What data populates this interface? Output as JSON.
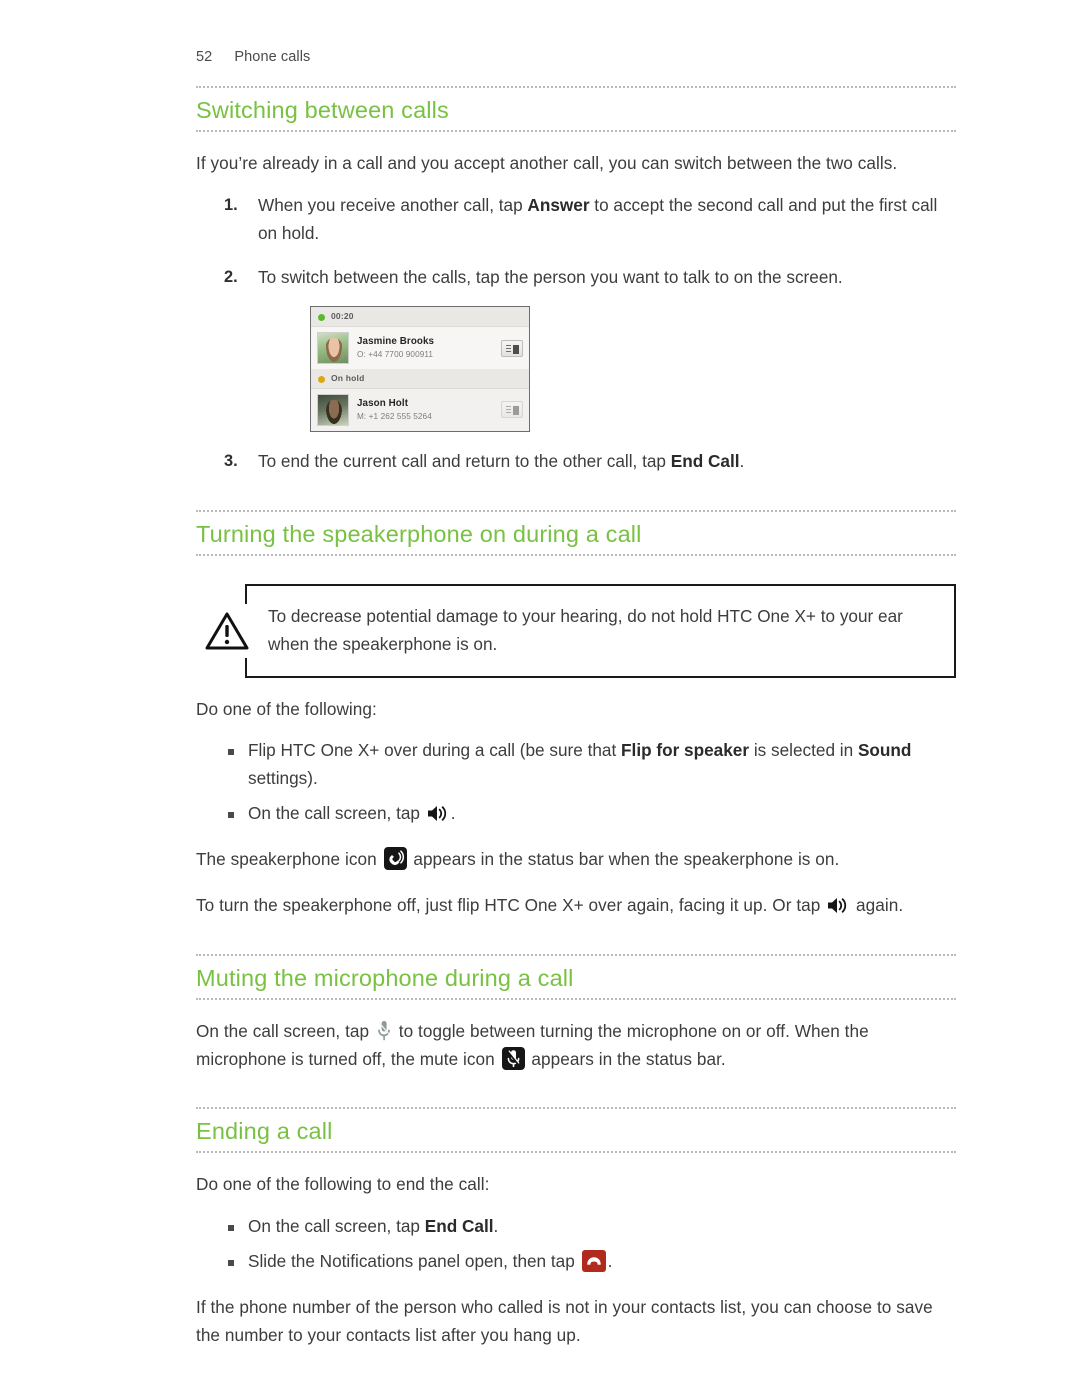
{
  "page": {
    "number": "52",
    "section": "Phone calls"
  },
  "colors": {
    "heading_green": "#79c143",
    "body_text": "#3d3d3d",
    "rule_dotted": "#b9b9b9",
    "end_call_red": "#b02a1d",
    "status_badge_black": "#161616"
  },
  "sections": [
    {
      "id": "switching",
      "heading": "Switching between calls",
      "intro": "If you’re already in a call and you accept another call, you can switch between the two calls.",
      "steps": [
        {
          "pre": "When you receive another call, tap ",
          "bold": "Answer",
          "post": " to accept the second call and put the first call on hold."
        },
        {
          "pre": "To switch between the calls, tap the person you want to talk to on the screen.",
          "bold": "",
          "post": ""
        },
        {
          "pre": "To end the current call and return to the other call, tap ",
          "bold": "End Call",
          "post": "."
        }
      ]
    },
    {
      "id": "speakerphone",
      "heading": "Turning the speakerphone on during a call",
      "warning": "To decrease potential damage to your hearing, do not hold HTC One X+ to your ear when the speakerphone is on.",
      "lead": "Do one of the following:",
      "bullets": [
        {
          "pre": "Flip HTC One X+ over during a call (be sure that ",
          "bold1": "Flip for speaker",
          "mid": " is selected in ",
          "bold2": "Sound",
          "post": " settings)."
        },
        {
          "pre": "On the call screen, tap ",
          "icon": "speaker-icon",
          "post": "."
        }
      ],
      "status_note_pre": "The speakerphone icon ",
      "status_note_icon": "speakerphone-status-icon",
      "status_note_post": " appears in the status bar when the speakerphone is on.",
      "off_note_pre": "To turn the speakerphone off, just flip HTC One X+ over again, facing it up. Or tap ",
      "off_note_icon": "speaker-icon",
      "off_note_post": " again."
    },
    {
      "id": "muting",
      "heading": "Muting the microphone during a call",
      "body_pre": "On the call screen, tap ",
      "body_icon_1": "microphone-icon",
      "body_mid": " to toggle between turning the microphone on or off. When the microphone is turned off, the mute icon ",
      "body_icon_2": "mute-status-icon",
      "body_post": " appears in the status bar."
    },
    {
      "id": "ending",
      "heading": "Ending a call",
      "lead": "Do one of the following to end the call:",
      "bullets": [
        {
          "pre": "On the call screen, tap ",
          "bold": "End Call",
          "post": "."
        },
        {
          "pre": "Slide the Notifications panel open, then tap ",
          "icon": "end-call-icon",
          "post": "."
        }
      ],
      "closing": "If the phone number of the person who called is not in your contacts list, you can choose to save the number to your contacts list after you hang up."
    }
  ],
  "phone_screenshot": {
    "active": {
      "status_label": "00:20",
      "status_dot": "green",
      "name": "Jasmine Brooks",
      "number": "O: +44 7700 900911",
      "action_icon": "keypad-icon"
    },
    "held": {
      "status_label": "On hold",
      "status_dot": "amber",
      "name": "Jason Holt",
      "number": "M: +1 262 555 5264",
      "action_icon": "keypad-icon"
    }
  }
}
